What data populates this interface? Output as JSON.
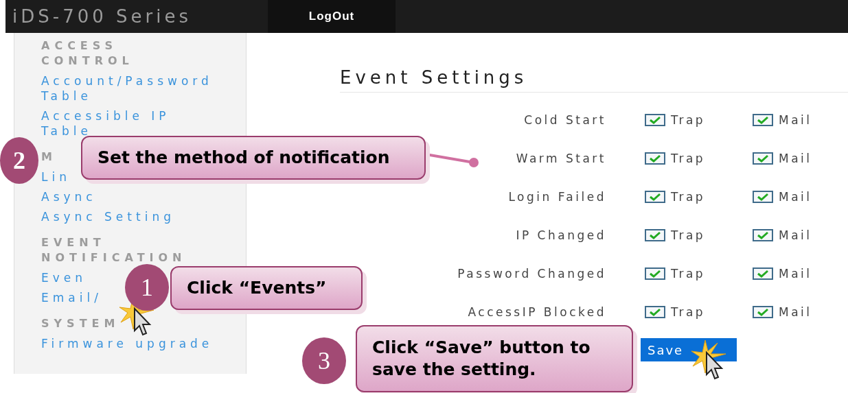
{
  "header": {
    "title": "iDS-700 Series",
    "logout": "LogOut"
  },
  "sidebar": {
    "sections": [
      {
        "heading": "ACCESS CONTROL",
        "items": [
          "Account/Password Table",
          "Accessible IP Table"
        ]
      },
      {
        "heading": "M",
        "items": [
          "Lin",
          "Async",
          "Async Setting"
        ]
      },
      {
        "heading": "EVENT NOTIFICATION",
        "items": [
          "Even",
          "Email/"
        ]
      },
      {
        "heading": "SYSTEM",
        "items": [
          "Firmware upgrade"
        ]
      }
    ]
  },
  "page": {
    "title": "Event Settings",
    "events": [
      {
        "label": "Cold Start",
        "trap": {
          "label": "Trap",
          "checked": true
        },
        "mail": {
          "label": "Mail",
          "checked": true
        }
      },
      {
        "label": "Warm Start",
        "trap": {
          "label": "Trap",
          "checked": true
        },
        "mail": {
          "label": "Mail",
          "checked": true
        }
      },
      {
        "label": "Login Failed",
        "trap": {
          "label": "Trap",
          "checked": true
        },
        "mail": {
          "label": "Mail",
          "checked": true
        }
      },
      {
        "label": "IP Changed",
        "trap": {
          "label": "Trap",
          "checked": true
        },
        "mail": {
          "label": "Mail",
          "checked": true
        }
      },
      {
        "label": "Password Changed",
        "trap": {
          "label": "Trap",
          "checked": true
        },
        "mail": {
          "label": "Mail",
          "checked": true
        }
      },
      {
        "label": "AccessIP Blocked",
        "trap": {
          "label": "Trap",
          "checked": true
        },
        "mail": {
          "label": "Mail",
          "checked": true
        }
      }
    ],
    "save_button": "Save"
  },
  "callouts": [
    {
      "number": "2",
      "text": "Set the method of notification"
    },
    {
      "number": "1",
      "text": "Click “Events”"
    },
    {
      "number": "3",
      "text": "Click “Save” button to save the setting."
    }
  ]
}
